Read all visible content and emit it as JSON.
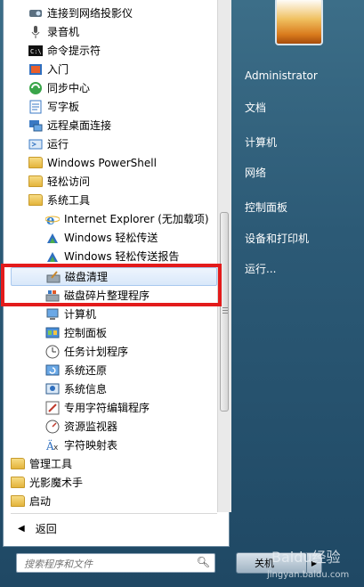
{
  "left_menu": {
    "items": [
      {
        "label": "连接到网络投影仪",
        "icon": "projector-icon",
        "type": "app"
      },
      {
        "label": "录音机",
        "icon": "microphone-icon",
        "type": "app"
      },
      {
        "label": "命令提示符",
        "icon": "cmd-icon",
        "type": "app"
      },
      {
        "label": "入门",
        "icon": "getting-started-icon",
        "type": "app"
      },
      {
        "label": "同步中心",
        "icon": "sync-center-icon",
        "type": "app"
      },
      {
        "label": "写字板",
        "icon": "wordpad-icon",
        "type": "app"
      },
      {
        "label": "远程桌面连接",
        "icon": "remote-desktop-icon",
        "type": "app"
      },
      {
        "label": "运行",
        "icon": "run-icon",
        "type": "app"
      },
      {
        "label": "Windows PowerShell",
        "icon": "folder-icon",
        "type": "folder"
      },
      {
        "label": "轻松访问",
        "icon": "folder-icon",
        "type": "folder"
      },
      {
        "label": "系统工具",
        "icon": "folder-icon",
        "type": "folder"
      },
      {
        "label": "Internet Explorer (无加载项)",
        "icon": "internet-explorer-icon",
        "type": "sub"
      },
      {
        "label": "Windows 轻松传送",
        "icon": "easy-transfer-icon",
        "type": "sub"
      },
      {
        "label": "Windows 轻松传送报告",
        "icon": "easy-transfer-reports-icon",
        "type": "sub"
      },
      {
        "label": "磁盘清理",
        "icon": "disk-cleanup-icon",
        "type": "sub"
      },
      {
        "label": "磁盘碎片整理程序",
        "icon": "disk-defragmenter-icon",
        "type": "sub"
      },
      {
        "label": "计算机",
        "icon": "computer-icon",
        "type": "sub"
      },
      {
        "label": "控制面板",
        "icon": "control-panel-icon",
        "type": "sub"
      },
      {
        "label": "任务计划程序",
        "icon": "task-scheduler-icon",
        "type": "sub"
      },
      {
        "label": "系统还原",
        "icon": "system-restore-icon",
        "type": "sub"
      },
      {
        "label": "系统信息",
        "icon": "system-info-icon",
        "type": "sub"
      },
      {
        "label": "专用字符编辑程序",
        "icon": "private-character-editor-icon",
        "type": "sub"
      },
      {
        "label": "资源监视器",
        "icon": "resource-monitor-icon",
        "type": "sub"
      },
      {
        "label": "字符映射表",
        "icon": "character-map-icon",
        "type": "sub"
      },
      {
        "label": "管理工具",
        "icon": "folder-icon",
        "type": "root-folder"
      },
      {
        "label": "光影魔术手",
        "icon": "folder-icon",
        "type": "root-folder"
      },
      {
        "label": "启动",
        "icon": "folder-icon",
        "type": "root-folder"
      }
    ],
    "back_label": "返回",
    "search_placeholder": "搜索程序和文件"
  },
  "right_menu": {
    "user": "Administrator",
    "links": [
      "文档",
      "计算机",
      "网络",
      "控制面板",
      "设备和打印机",
      "运行..."
    ],
    "shutdown_label": "关机"
  },
  "watermark": {
    "logo": "Baidu经验",
    "url": "jingyan.baidu.com"
  },
  "colors": {
    "highlight_box": "#e31b1b",
    "selection": "#d9e8fa",
    "taskbar_blue": "#2c5a76"
  }
}
